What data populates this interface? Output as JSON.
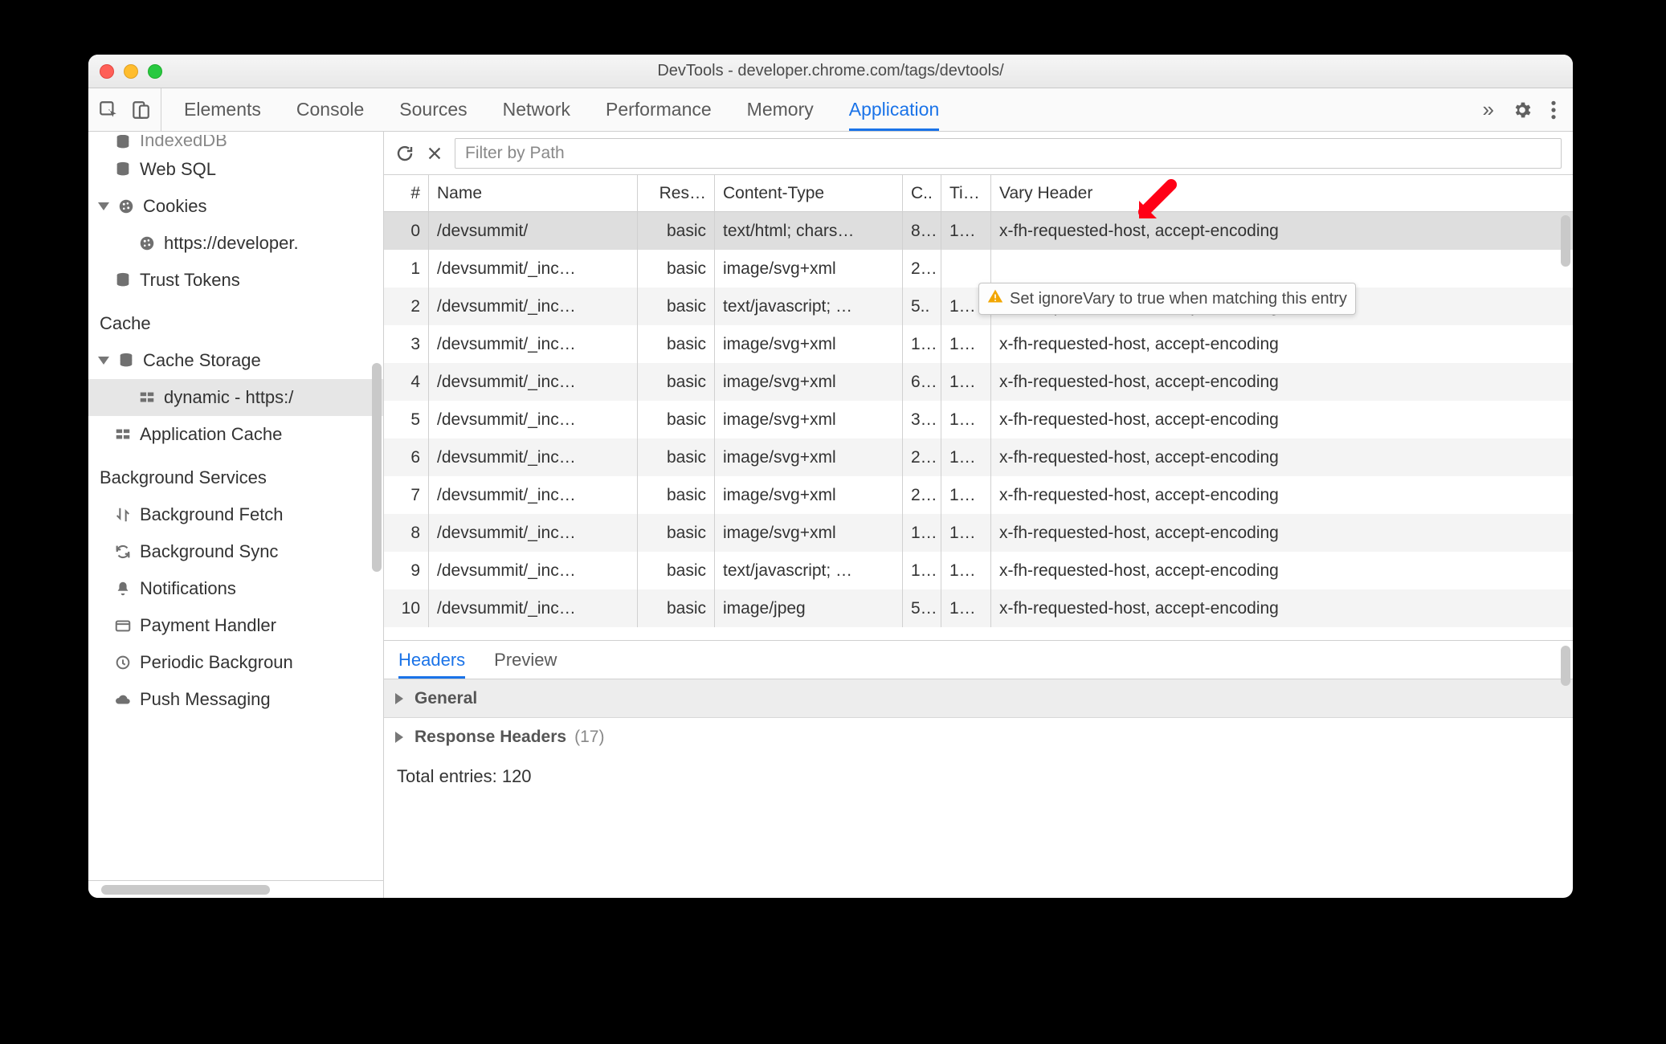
{
  "window_title": "DevTools - developer.chrome.com/tags/devtools/",
  "tabs": [
    "Elements",
    "Console",
    "Sources",
    "Network",
    "Performance",
    "Memory",
    "Application"
  ],
  "active_tab": "Application",
  "sidebar": {
    "items": [
      {
        "label": "IndexedDB",
        "icon": "database",
        "indent": 1,
        "top_cut": true
      },
      {
        "label": "Web SQL",
        "icon": "database",
        "indent": 1
      },
      {
        "label": "Cookies",
        "icon": "cookie",
        "indent": 0,
        "expandable": true,
        "expanded": true
      },
      {
        "label": "https://developer.",
        "icon": "cookie",
        "indent": 2
      },
      {
        "label": "Trust Tokens",
        "icon": "database",
        "indent": 1
      }
    ],
    "cache_heading": "Cache",
    "cache_items": [
      {
        "label": "Cache Storage",
        "icon": "database",
        "indent": 0,
        "expandable": true,
        "expanded": true
      },
      {
        "label": "dynamic - https:/",
        "icon": "grid",
        "indent": 2,
        "selected": true
      },
      {
        "label": "Application Cache",
        "icon": "grid",
        "indent": 1
      }
    ],
    "bg_heading": "Background Services",
    "bg_items": [
      {
        "label": "Background Fetch",
        "icon": "updown"
      },
      {
        "label": "Background Sync",
        "icon": "sync"
      },
      {
        "label": "Notifications",
        "icon": "bell"
      },
      {
        "label": "Payment Handler",
        "icon": "card"
      },
      {
        "label": "Periodic Backgroun",
        "icon": "clock"
      },
      {
        "label": "Push Messaging",
        "icon": "cloud"
      }
    ]
  },
  "toolbar": {
    "filter_placeholder": "Filter by Path"
  },
  "table": {
    "headers": {
      "idx": "#",
      "name": "Name",
      "res": "Res…",
      "ct": "Content-Type",
      "c": "C..",
      "ti": "Ti…",
      "vary": "Vary Header"
    },
    "rows": [
      {
        "idx": "0",
        "name": "/devsummit/",
        "res": "basic",
        "ct": "text/html; chars…",
        "c": "8…",
        "ti": "1…",
        "vary": "x-fh-requested-host, accept-encoding",
        "selected": true
      },
      {
        "idx": "1",
        "name": "/devsummit/_inc…",
        "res": "basic",
        "ct": "image/svg+xml",
        "c": "2…",
        "ti": "",
        "vary": ""
      },
      {
        "idx": "2",
        "name": "/devsummit/_inc…",
        "res": "basic",
        "ct": "text/javascript; …",
        "c": "5..",
        "ti": "1…",
        "vary": "x-fh-requested-host, accept-encoding"
      },
      {
        "idx": "3",
        "name": "/devsummit/_inc…",
        "res": "basic",
        "ct": "image/svg+xml",
        "c": "1…",
        "ti": "1…",
        "vary": "x-fh-requested-host, accept-encoding"
      },
      {
        "idx": "4",
        "name": "/devsummit/_inc…",
        "res": "basic",
        "ct": "image/svg+xml",
        "c": "6…",
        "ti": "1…",
        "vary": "x-fh-requested-host, accept-encoding"
      },
      {
        "idx": "5",
        "name": "/devsummit/_inc…",
        "res": "basic",
        "ct": "image/svg+xml",
        "c": "3…",
        "ti": "1…",
        "vary": "x-fh-requested-host, accept-encoding"
      },
      {
        "idx": "6",
        "name": "/devsummit/_inc…",
        "res": "basic",
        "ct": "image/svg+xml",
        "c": "2…",
        "ti": "1…",
        "vary": "x-fh-requested-host, accept-encoding"
      },
      {
        "idx": "7",
        "name": "/devsummit/_inc…",
        "res": "basic",
        "ct": "image/svg+xml",
        "c": "2…",
        "ti": "1…",
        "vary": "x-fh-requested-host, accept-encoding"
      },
      {
        "idx": "8",
        "name": "/devsummit/_inc…",
        "res": "basic",
        "ct": "image/svg+xml",
        "c": "1…",
        "ti": "1…",
        "vary": "x-fh-requested-host, accept-encoding"
      },
      {
        "idx": "9",
        "name": "/devsummit/_inc…",
        "res": "basic",
        "ct": "text/javascript; …",
        "c": "1…",
        "ti": "1…",
        "vary": "x-fh-requested-host, accept-encoding"
      },
      {
        "idx": "10",
        "name": "/devsummit/_inc…",
        "res": "basic",
        "ct": "image/jpeg",
        "c": "5…",
        "ti": "1…",
        "vary": "x-fh-requested-host, accept-encoding"
      }
    ]
  },
  "tooltip_text": "Set ignoreVary to true when matching this entry",
  "details": {
    "tabs": [
      "Headers",
      "Preview"
    ],
    "active": "Headers",
    "general_label": "General",
    "response_headers_label": "Response Headers",
    "response_headers_count": "(17)",
    "total_entries_label": "Total entries: 120"
  }
}
